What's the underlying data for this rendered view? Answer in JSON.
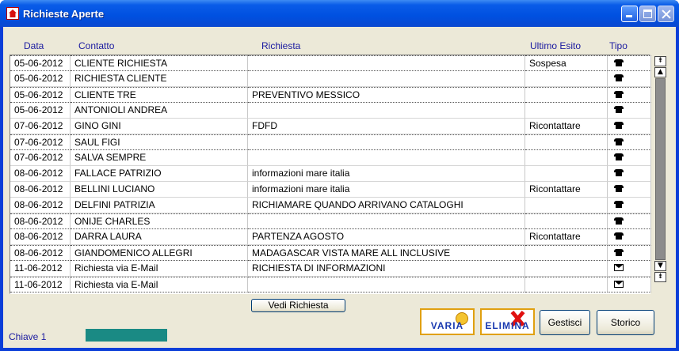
{
  "window": {
    "title": "Richieste Aperte",
    "controls": [
      "minimize-icon",
      "maximize-icon",
      "close-icon"
    ]
  },
  "columns": {
    "data": "Data",
    "contatto": "Contatto",
    "richiesta": "Richiesta",
    "esito": "Ultimo Esito",
    "tipo": "Tipo"
  },
  "rows": [
    {
      "data": "05-06-2012",
      "contatto": "CLIENTE RICHIESTA",
      "richiesta": "",
      "esito": "Sospesa",
      "tipo": "phone",
      "dotted": true
    },
    {
      "data": "05-06-2012",
      "contatto": "RICHIESTA CLIENTE",
      "richiesta": "",
      "esito": "",
      "tipo": "phone",
      "dotted": false
    },
    {
      "data": "05-06-2012",
      "contatto": "CLIENTE TRE",
      "richiesta": "PREVENTIVO MESSICO",
      "esito": "",
      "tipo": "phone",
      "dotted": true
    },
    {
      "data": "05-06-2012",
      "contatto": "ANTONIOLI ANDREA",
      "richiesta": "",
      "esito": "",
      "tipo": "phone",
      "dotted": false
    },
    {
      "data": "07-06-2012",
      "contatto": "GINO GINI",
      "richiesta": "FDFD",
      "esito": "Ricontattare",
      "tipo": "phone",
      "dotted": false
    },
    {
      "data": "07-06-2012",
      "contatto": "SAUL FIGI",
      "richiesta": "",
      "esito": "",
      "tipo": "phone",
      "dotted": true
    },
    {
      "data": "07-06-2012",
      "contatto": "SALVA SEMPRE",
      "richiesta": "",
      "esito": "",
      "tipo": "phone",
      "dotted": false
    },
    {
      "data": "08-06-2012",
      "contatto": "FALLACE PATRIZIO",
      "richiesta": "informazioni mare italia",
      "esito": "",
      "tipo": "phone",
      "dotted": false
    },
    {
      "data": "08-06-2012",
      "contatto": "BELLINI LUCIANO",
      "richiesta": "informazioni mare italia",
      "esito": "Ricontattare",
      "tipo": "phone",
      "dotted": false
    },
    {
      "data": "08-06-2012",
      "contatto": "DELFINI PATRIZIA",
      "richiesta": "RICHIAMARE QUANDO ARRIVANO CATALOGHI",
      "esito": "",
      "tipo": "phone",
      "dotted": false
    },
    {
      "data": "08-06-2012",
      "contatto": "ONIJE CHARLES",
      "richiesta": "",
      "esito": "",
      "tipo": "phone",
      "dotted": true
    },
    {
      "data": "08-06-2012",
      "contatto": "DARRA LAURA",
      "richiesta": "PARTENZA AGOSTO",
      "esito": "Ricontattare",
      "tipo": "phone",
      "dotted": false
    },
    {
      "data": "08-06-2012",
      "contatto": "GIANDOMENICO ALLEGRI",
      "richiesta": "MADAGASCAR VISTA MARE ALL INCLUSIVE",
      "esito": "",
      "tipo": "phone",
      "dotted": true
    },
    {
      "data": "11-06-2012",
      "contatto": "Richiesta via E-Mail",
      "richiesta": "RICHIESTA DI INFORMAZIONI",
      "esito": "",
      "tipo": "mail",
      "dotted": false
    },
    {
      "data": "11-06-2012",
      "contatto": "Richiesta via E-Mail",
      "richiesta": "",
      "esito": "",
      "tipo": "mail",
      "dotted": true
    }
  ],
  "buttons": {
    "vedi": "Vedi Richiesta",
    "varia": "VARIA",
    "elimina": "ELIMINA",
    "gestisci": "Gestisci",
    "storico": "Storico"
  },
  "status": {
    "label": "Chiave 1",
    "progress": 1.0
  },
  "colors": {
    "titlebar": "#0a5ce8",
    "client_bg": "#ece9d8",
    "header_text": "#1a1aa0",
    "progress_fill": "#1a8a84"
  }
}
